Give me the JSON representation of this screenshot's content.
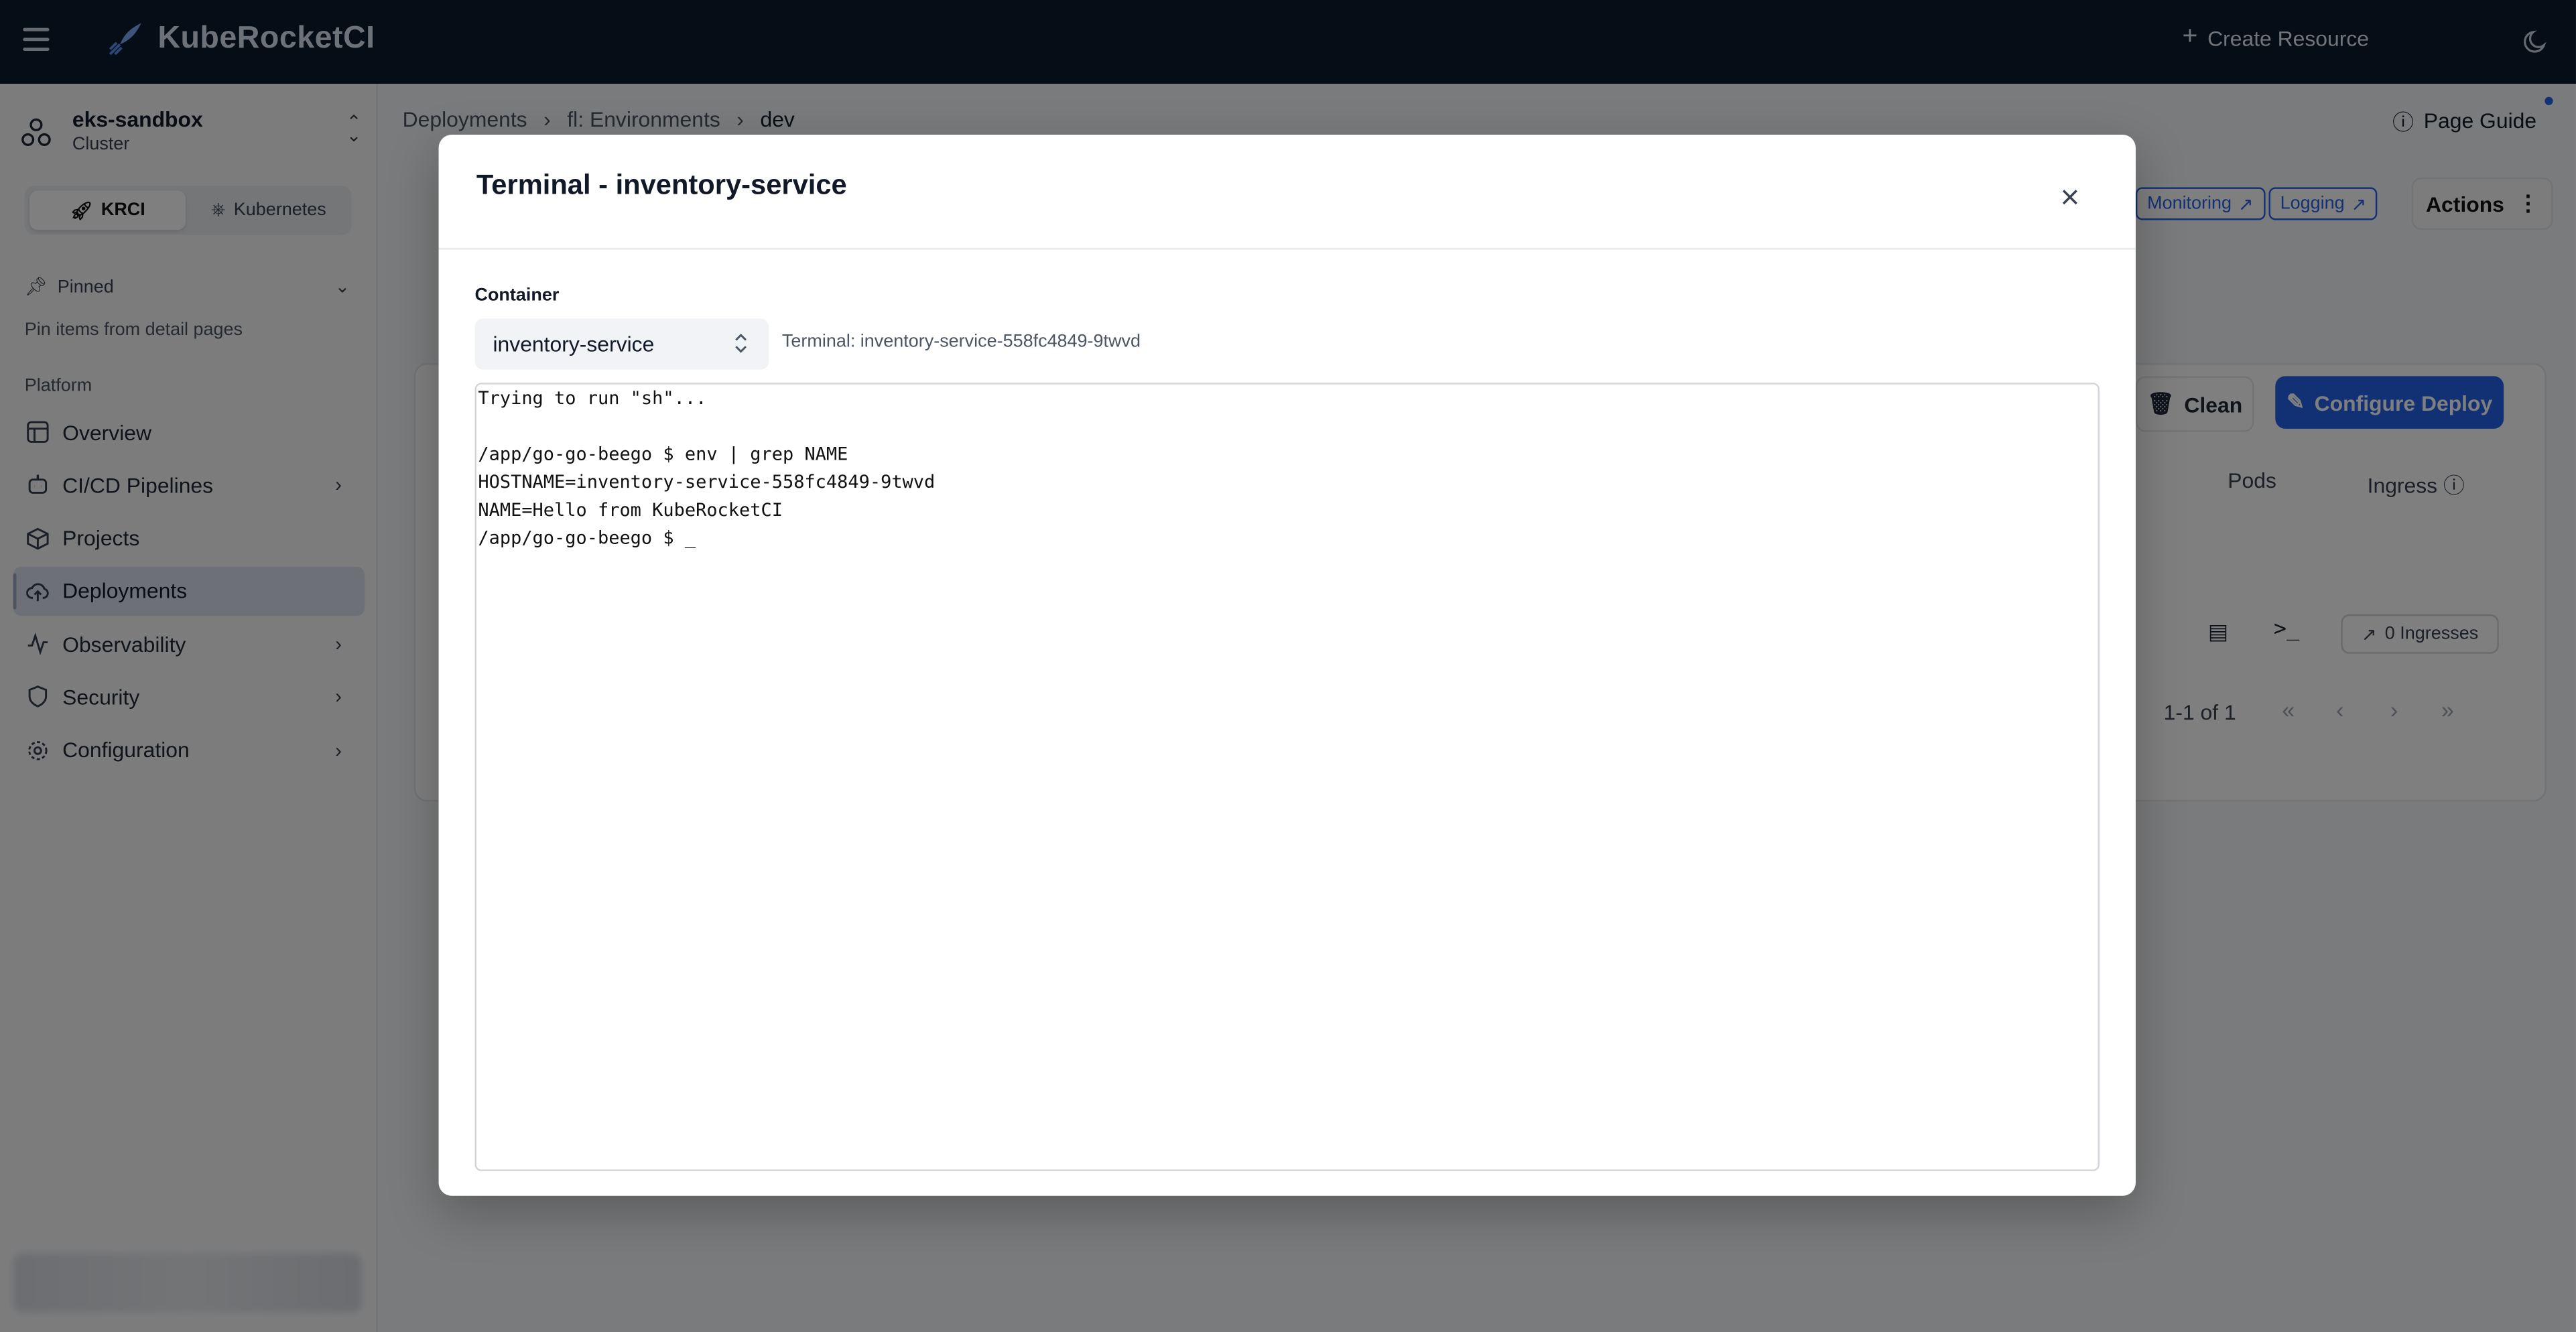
{
  "header": {
    "brand": "KubeRocketCI",
    "create_resource": "Create Resource"
  },
  "sidebar": {
    "cluster_name": "eks-sandbox",
    "cluster_type": "Cluster",
    "switch_krci": "KRCI",
    "switch_kubernetes": "Kubernetes",
    "pinned_label": "Pinned",
    "pinned_hint": "Pin items from detail pages",
    "section_platform": "Platform",
    "items": [
      {
        "label": "Overview",
        "icon": "overview-icon"
      },
      {
        "label": "CI/CD Pipelines",
        "icon": "pipelines-icon"
      },
      {
        "label": "Projects",
        "icon": "projects-icon"
      },
      {
        "label": "Deployments",
        "icon": "deployments-icon"
      },
      {
        "label": "Observability",
        "icon": "observability-icon"
      },
      {
        "label": "Security",
        "icon": "security-icon"
      },
      {
        "label": "Configuration",
        "icon": "configuration-icon"
      }
    ]
  },
  "main": {
    "breadcrumbs": [
      "Deployments",
      "fl: Environments",
      "dev"
    ],
    "page_guide": "Page Guide",
    "monitoring": "Monitoring",
    "logging": "Logging",
    "actions": "Actions",
    "clean": "Clean",
    "configure_deploy": "Configure Deploy",
    "col_pods": "Pods",
    "col_ingress": "Ingress",
    "ingresses": "0 Ingresses",
    "pager": "1-1 of 1"
  },
  "modal": {
    "title": "Terminal - inventory-service",
    "container_label": "Container",
    "container_value": "inventory-service",
    "terminal_label": "Terminal: inventory-service-558fc4849-9twvd",
    "terminal_lines": [
      "Trying to run \"sh\"...",
      "",
      "/app/go-go-beego $ env | grep NAME",
      "HOSTNAME=inventory-service-558fc4849-9twvd",
      "NAME=Hello from KubeRocketCI",
      "/app/go-go-beego $ _"
    ]
  },
  "colors": {
    "header_bg": "#0b1a2e",
    "accent": "#2563eb"
  }
}
